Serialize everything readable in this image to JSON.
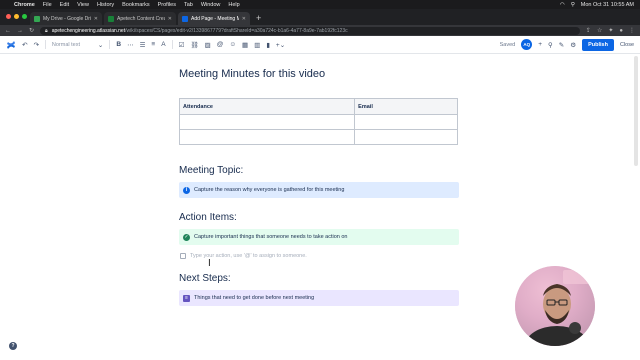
{
  "menubar": {
    "app": "Chrome",
    "items": [
      "File",
      "Edit",
      "View",
      "History",
      "Bookmarks",
      "Profiles",
      "Tab",
      "Window",
      "Help"
    ],
    "clock": "Mon Oct 31  10:55 AM"
  },
  "tabs": [
    {
      "title": "My Drive - Google Drive",
      "color": "#34a853"
    },
    {
      "title": "Apetech Content Creation - Go",
      "color": "#188038"
    },
    {
      "title": "Add Page - Meeting Minutes f",
      "color": "#0c66e4"
    }
  ],
  "omnibox": {
    "domain": "apetechengineering.atlassian.net",
    "path": "/wiki/spaces/CS/pages/edit-v2/1339867779?draftShareId=a30a724c-b1a6-4a77-8a9e-7ab192fc123c"
  },
  "editor_toolbar": {
    "text_style": "Normal text",
    "saved": "Saved",
    "avatar_initials": "AQ",
    "publish": "Publish",
    "close": "Close"
  },
  "page": {
    "title": "Meeting Minutes for this video",
    "table": {
      "headers": [
        "Attendance",
        "Email"
      ],
      "rows": [
        [
          "",
          ""
        ],
        [
          "",
          ""
        ]
      ]
    },
    "meeting_topic": {
      "heading": "Meeting Topic:",
      "panel": "Capture the reason why everyone is gathered for this meeting",
      "color": "#0c66e4"
    },
    "action_items": {
      "heading": "Action Items:",
      "panel": "Capture important things that someone needs to take action on",
      "task_placeholder": "Type your action, use '@' to assign to someone.",
      "color": "#1f845a"
    },
    "next_steps": {
      "heading": "Next Steps:",
      "panel": "Things that need to get done before next meeting",
      "color": "#6554c0"
    }
  }
}
